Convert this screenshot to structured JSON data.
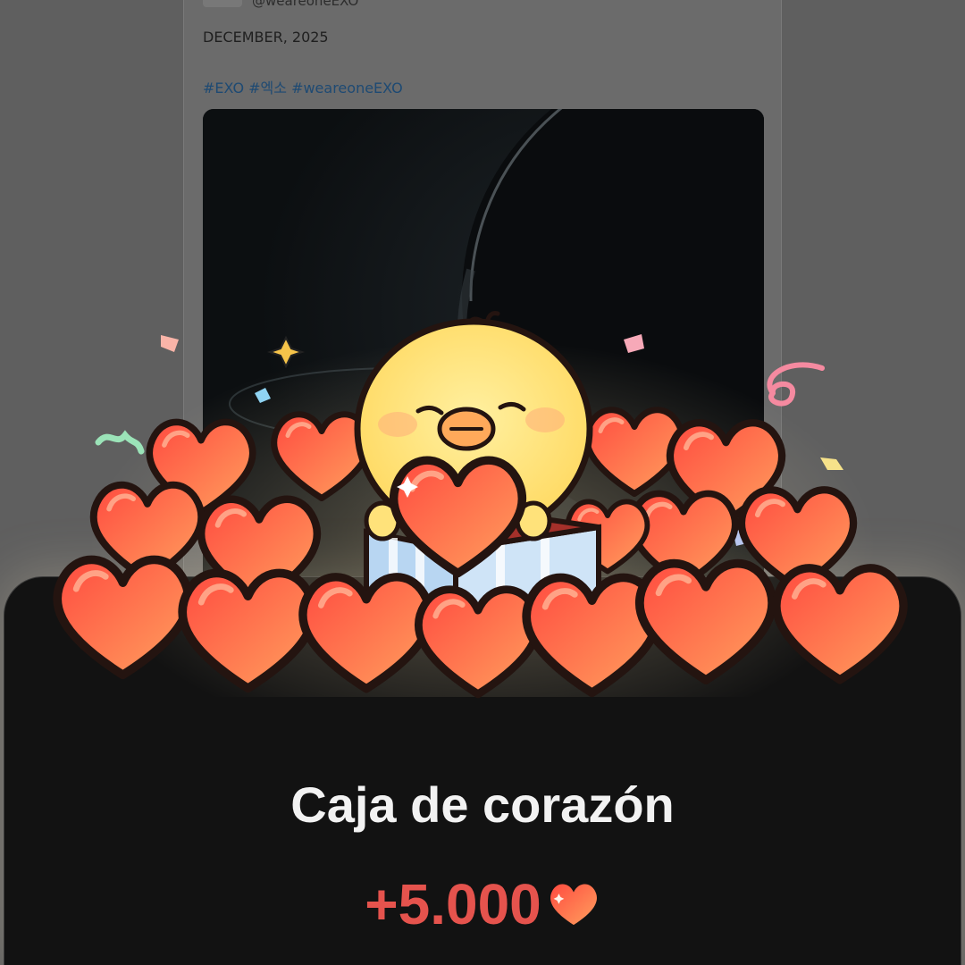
{
  "post": {
    "handle": "@weareoneEXO",
    "date_text": "DECEMBER, 2025",
    "hashtags": "#EXO #엑소 #weareoneEXO"
  },
  "reward": {
    "title": "Caja de corazón",
    "amount": "+5.000",
    "currency_icon": "heart-icon"
  },
  "colors": {
    "amount_red": "#e5534d",
    "heart_light": "#ff9a5a",
    "heart_dark": "#ff4a3d",
    "chick_yellow": "#ffe27a"
  }
}
